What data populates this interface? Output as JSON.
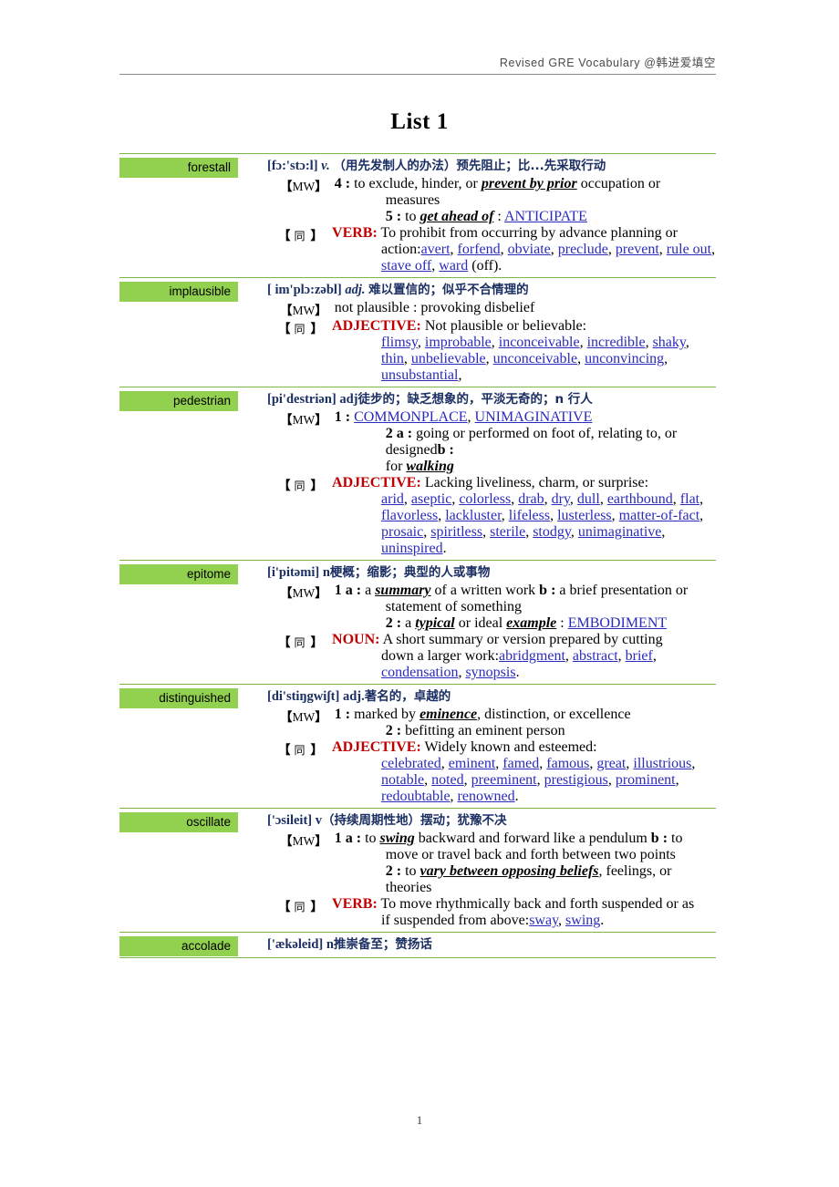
{
  "header": {
    "running_head": "Revised  GRE  Vocabulary  @韩进爱填空"
  },
  "title": "List 1",
  "footer": {
    "page_number": "1"
  },
  "labels": {
    "mw_tag_open": "【",
    "mw_tag_text": "MW",
    "mw_tag_close": "】",
    "syn_tag_open": "【",
    "syn_tag_text": "同",
    "syn_tag_close": "】"
  },
  "colors": {
    "badge_green": "#92d050",
    "rule_green": "#7ab648",
    "headword_navy": "#1b2f63",
    "pos_red": "#c00000",
    "link_blue": "#2b2bbb",
    "header_gray": "#8a8a8a"
  },
  "entries": [
    {
      "word": "forestall",
      "phonetic": "[fɔ:'stɔ:l]",
      "pos": "v.",
      "pos_italic": true,
      "chinese": "（用先发制人的办法）预先阻止；比...先采取行动",
      "mw": {
        "lines": [
          {
            "num": "4 :",
            "pre": "to exclude, hinder, or ",
            "emph": "prevent by prior",
            "post": " occupation or",
            "indent": false
          },
          {
            "num": "",
            "pre": "measures",
            "emph": "",
            "post": "",
            "indent": true
          },
          {
            "num": "5 :",
            "pre": "to ",
            "emph": "get ahead of",
            "post": " : ",
            "xref": "ANTICIPATE",
            "indent": true
          }
        ]
      },
      "syn": {
        "pos_label": "VERB:",
        "definition": "To prohibit from occurring by advance planning or",
        "definition_cont": "action:",
        "words": [
          "avert",
          "forfend",
          "obviate",
          "preclude",
          "prevent",
          "rule out",
          "stave off",
          "ward"
        ],
        "trailer": " (off)."
      }
    },
    {
      "word": "implausible",
      "phonetic": "[ im'plɔ:zəbl]",
      "pos": "adj.",
      "pos_italic": true,
      "chinese": "难以置信的；似乎不合情理的",
      "mw": {
        "lines": [
          {
            "num": "",
            "pre": "not plausible : provoking disbelief",
            "emph": "",
            "post": "",
            "indent": false
          }
        ]
      },
      "syn": {
        "pos_label": "ADJECTIVE:",
        "definition": "Not plausible or believable:",
        "definition_cont": "",
        "words": [
          "flimsy",
          "improbable",
          "inconceivable",
          "incredible",
          "shaky",
          "thin",
          "unbelievable",
          "unconceivable",
          "unconvincing",
          "unsubstantial"
        ],
        "trailer": ","
      }
    },
    {
      "word": "pedestrian",
      "phonetic": "[pi'destriən]",
      "pos": "adj",
      "pos_italic": false,
      "chinese": "徒步的；缺乏想象的，平淡无奇的；n  行人",
      "mw": {
        "lines": [
          {
            "num": "1 :",
            "pre": "",
            "xref_list": [
              "COMMONPLACE",
              "UNIMAGINATIVE"
            ],
            "indent": false
          },
          {
            "num": "2 a :",
            "pre": "going or performed on foot ",
            "bold_b": "b :",
            "post": " of, relating to, or designed",
            "indent": true
          },
          {
            "num": "",
            "pre": "for ",
            "emph": "walking",
            "post": "",
            "indent": true
          }
        ]
      },
      "syn": {
        "pos_label": "ADJECTIVE:",
        "definition": "Lacking liveliness, charm, or surprise:",
        "definition_cont": "",
        "words": [
          "arid",
          "aseptic",
          "colorless",
          "drab",
          "dry",
          "dull",
          "earthbound",
          "flat",
          "flavorless",
          "lackluster",
          "lifeless",
          "lusterless",
          "matter-of-fact",
          "prosaic",
          "spiritless",
          "sterile",
          "stodgy",
          "unimaginative",
          "uninspired"
        ],
        "trailer": "."
      }
    },
    {
      "word": "epitome",
      "phonetic": "[i'pitəmi]",
      "pos": "n",
      "pos_italic": false,
      "chinese": "梗概；缩影；典型的人或事物",
      "mw": {
        "lines": [
          {
            "num": "1 a :",
            "pre": "a ",
            "emph": "summary",
            "post": " of a written work ",
            "bold_b": "b :",
            "post2": " a brief presentation or",
            "indent": false
          },
          {
            "num": "",
            "pre": "statement of something",
            "emph": "",
            "post": "",
            "indent": true
          },
          {
            "num": "2 :",
            "pre": "a ",
            "emph": "typical",
            "mid": " or ideal ",
            "emph2": "example",
            "post": " : ",
            "xref": "EMBODIMENT",
            "indent": true
          }
        ]
      },
      "syn": {
        "pos_label": "NOUN:",
        "definition": "A short summary or version prepared by cutting",
        "definition_cont": "down a larger work:",
        "words": [
          "abridgment",
          "abstract",
          "brief",
          "condensation",
          "synopsis"
        ],
        "trailer": "."
      }
    },
    {
      "word": "distinguished",
      "phonetic": "[di'stiŋgwiʃt]",
      "pos": "adj.",
      "pos_italic": false,
      "chinese": "著名的，卓越的",
      "mw": {
        "lines": [
          {
            "num": "1 :",
            "pre": "marked by ",
            "emph": "eminence",
            "post": ", distinction, or excellence",
            "indent": false
          },
          {
            "num": "2 :",
            "pre": "befitting an eminent person",
            "emph": "",
            "post": "",
            "indent": true
          }
        ]
      },
      "syn": {
        "pos_label": "ADJECTIVE:",
        "definition": "Widely known and esteemed:",
        "definition_cont": "",
        "words": [
          "celebrated",
          "eminent",
          "famed",
          "famous",
          "great",
          "illustrious",
          "notable",
          "noted",
          "preeminent",
          "prestigious",
          "prominent",
          "redoubtable",
          "renowned"
        ],
        "trailer": "."
      }
    },
    {
      "word": "oscillate",
      "phonetic": "['ɔsileit]",
      "pos": "v",
      "pos_italic": false,
      "chinese": "（持续周期性地）摆动；犹豫不决",
      "mw": {
        "lines": [
          {
            "num": "1 a :",
            "pre": "to ",
            "emph": "swing",
            "post": " backward and forward like a pendulum ",
            "bold_b": "b :",
            "post2": " to",
            "indent": false
          },
          {
            "num": "",
            "pre": "move or travel back and forth between two points",
            "emph": "",
            "post": "",
            "indent": true
          },
          {
            "num": "2 :",
            "pre": "to ",
            "emph": "vary between opposing beliefs",
            "post": ", feelings, or theories",
            "indent": true
          }
        ]
      },
      "syn": {
        "pos_label": "VERB:",
        "definition": "To move rhythmically back and forth suspended or as",
        "definition_cont": "if suspended from above:",
        "words": [
          "sway",
          "swing"
        ],
        "trailer": "."
      }
    },
    {
      "word": "accolade",
      "phonetic": "['ækəleid]",
      "pos": "n",
      "pos_italic": false,
      "chinese": "推崇备至；赞扬话",
      "mw": {
        "lines": []
      },
      "syn": null
    }
  ]
}
